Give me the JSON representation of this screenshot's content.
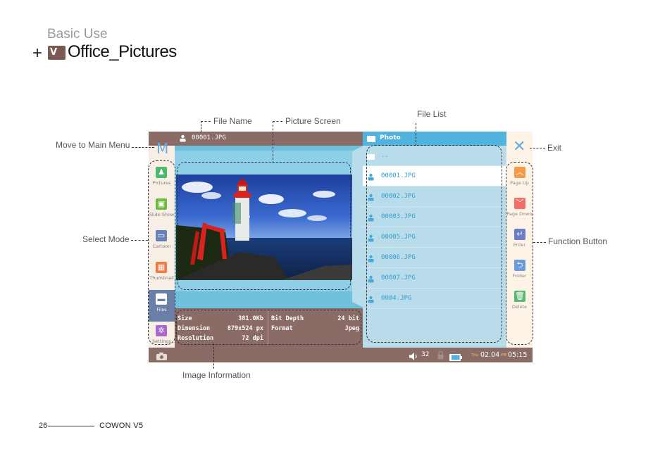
{
  "heading": {
    "section": "Basic Use",
    "plus": "+",
    "title": "Office_Pictures",
    "logo_text": "V"
  },
  "device": {
    "current_file": "00001.JPG",
    "folder": "Photo",
    "parent_entry": "..",
    "files": [
      "00001.JPG",
      "00002.JPG",
      "00003.JPG",
      "00005.JPG",
      "00006.JPG",
      "00007.JPG",
      "0004.JPG"
    ],
    "selected_index": 0,
    "main_menu_glyph": "M",
    "exit_glyph": "✕",
    "modes": [
      {
        "label": "Pictures",
        "icon": "person-icon",
        "color": "#4cb86a",
        "glyph": "♟"
      },
      {
        "label": "Slide Show",
        "icon": "slideshow-icon",
        "color": "#6cbb3c",
        "glyph": "▣"
      },
      {
        "label": "Cartoon",
        "icon": "cartoon-icon",
        "color": "#6a7fb8",
        "glyph": "▭"
      },
      {
        "label": "Thumbnail",
        "icon": "grid-icon",
        "color": "#f07a45",
        "glyph": "▦"
      },
      {
        "label": "Files",
        "icon": "folder-icon",
        "color": "#ffffff",
        "glyph": "▬"
      },
      {
        "label": "Settings",
        "icon": "gear-icon",
        "color": "#a86ad0",
        "glyph": "✲"
      }
    ],
    "active_mode": 4,
    "functions": [
      {
        "label": "Page Up",
        "icon": "chevron-up-icon",
        "color": "#f59a4a",
        "glyph": "︿"
      },
      {
        "label": "Page Down",
        "icon": "chevron-down-icon",
        "color": "#f07068",
        "glyph": "﹀"
      },
      {
        "label": "Enter",
        "icon": "enter-icon",
        "color": "#6a7fc8",
        "glyph": "↵"
      },
      {
        "label": "Folder",
        "icon": "folder-back-icon",
        "color": "#6a9ad8",
        "glyph": "⮌"
      },
      {
        "label": "Delete",
        "icon": "trash-icon",
        "color": "#5ab870",
        "glyph": "🗑"
      }
    ],
    "info": {
      "size_label": "Size",
      "size_value": "381.0Kb",
      "dimension_label": "Dimension",
      "dimension_value": "879x524 px",
      "resolution_label": "Resolution",
      "resolution_value": "72 dpi",
      "bitdepth_label": "Bit Depth",
      "bitdepth_value": "24 bit",
      "format_label": "Format",
      "format_value": "Jpeg"
    },
    "status": {
      "volume": "32",
      "day": "Thu",
      "date": "02.04",
      "ampm": "PM",
      "time": "05:15"
    }
  },
  "callouts": {
    "file_name": "File Name",
    "picture_screen": "Picture Screen",
    "file_list": "File List",
    "main_menu": "Move to Main Menu",
    "exit": "Exit",
    "select_mode": "Select Mode",
    "function_button": "Function Button",
    "image_information": "Image Information"
  },
  "footer": {
    "page": "26",
    "brand": "COWON V5"
  }
}
